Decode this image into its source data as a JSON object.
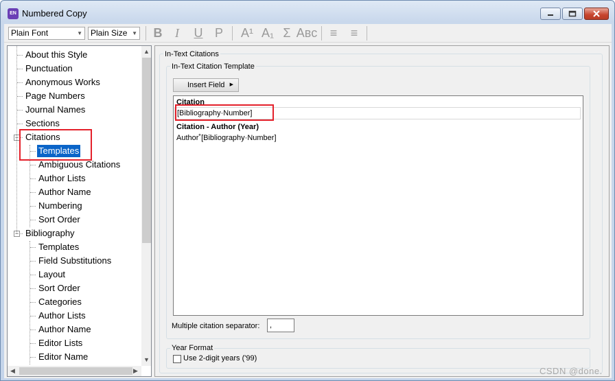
{
  "window": {
    "title": "Numbered Copy",
    "app_icon": "EN"
  },
  "toolbar": {
    "font": "Plain Font",
    "size": "Plain Size",
    "buttons": [
      {
        "icon": "bold-icon",
        "glyph": "B"
      },
      {
        "icon": "italic-icon",
        "glyph": "I"
      },
      {
        "icon": "underline-icon",
        "glyph": "U"
      },
      {
        "icon": "plain-icon",
        "glyph": "P"
      },
      {
        "icon": "superscript-icon",
        "glyph": "A¹"
      },
      {
        "icon": "subscript-icon",
        "glyph": "A₁"
      },
      {
        "icon": "symbol-icon",
        "glyph": "Σ"
      },
      {
        "icon": "small-caps-icon",
        "glyph": "Aʙᴄ"
      },
      {
        "icon": "align-left-icon",
        "glyph": "≡"
      },
      {
        "icon": "align-center-icon",
        "glyph": "≡"
      }
    ]
  },
  "tree": {
    "items": [
      {
        "label": "About this Style",
        "level": 0
      },
      {
        "label": "Punctuation",
        "level": 0
      },
      {
        "label": "Anonymous Works",
        "level": 0
      },
      {
        "label": "Page Numbers",
        "level": 0
      },
      {
        "label": "Journal Names",
        "level": 0
      },
      {
        "label": "Sections",
        "level": 0
      },
      {
        "label": "Citations",
        "level": 0,
        "expander": "−"
      },
      {
        "label": "Templates",
        "level": 1,
        "selected": true
      },
      {
        "label": "Ambiguous Citations",
        "level": 1
      },
      {
        "label": "Author Lists",
        "level": 1
      },
      {
        "label": "Author Name",
        "level": 1
      },
      {
        "label": "Numbering",
        "level": 1
      },
      {
        "label": "Sort Order",
        "level": 1
      },
      {
        "label": "Bibliography",
        "level": 0,
        "expander": "−"
      },
      {
        "label": "Templates",
        "level": 1
      },
      {
        "label": "Field Substitutions",
        "level": 1
      },
      {
        "label": "Layout",
        "level": 1
      },
      {
        "label": "Sort Order",
        "level": 1
      },
      {
        "label": "Categories",
        "level": 1
      },
      {
        "label": "Author Lists",
        "level": 1
      },
      {
        "label": "Author Name",
        "level": 1
      },
      {
        "label": "Editor Lists",
        "level": 1
      },
      {
        "label": "Editor Name",
        "level": 1
      }
    ]
  },
  "panel": {
    "section_title": "In-Text Citations",
    "template_group": "In-Text Citation Template",
    "insert_field": "Insert Field",
    "editor": {
      "citation_heading": "Citation",
      "citation_value": "[Bibliography·Number]",
      "author_year_heading": "Citation - Author (Year)",
      "author_year_value": "Author˚[Bibliography·Number]"
    },
    "separator_label": "Multiple citation separator:",
    "separator_value": ",",
    "year_format_group": "Year Format",
    "two_digit_years_label": "Use 2-digit years ('99)",
    "two_digit_years_checked": false
  },
  "watermark": "CSDN @done.",
  "colors": {
    "highlight": "#e4202a",
    "selection": "#0a64c8"
  }
}
